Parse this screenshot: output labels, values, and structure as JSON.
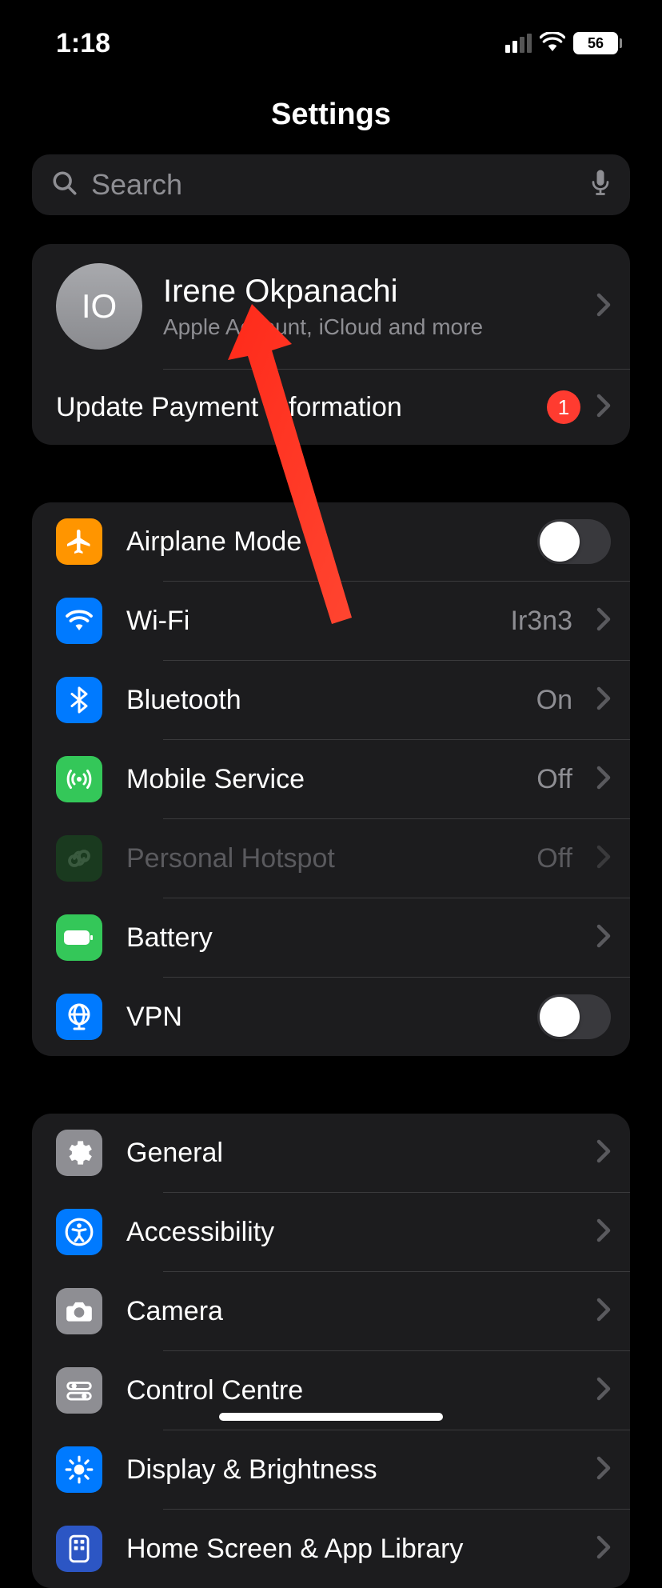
{
  "status": {
    "time": "1:18",
    "battery": "56"
  },
  "header": {
    "title": "Settings"
  },
  "search": {
    "placeholder": "Search"
  },
  "profile": {
    "initials": "IO",
    "name": "Irene Okpanachi",
    "subtitle": "Apple Account, iCloud and more",
    "payment_label": "Update Payment Information",
    "badge": "1"
  },
  "group1": {
    "airplane": {
      "label": "Airplane Mode"
    },
    "wifi": {
      "label": "Wi-Fi",
      "value": "Ir3n3"
    },
    "bluetooth": {
      "label": "Bluetooth",
      "value": "On"
    },
    "mobile": {
      "label": "Mobile Service",
      "value": "Off"
    },
    "hotspot": {
      "label": "Personal Hotspot",
      "value": "Off"
    },
    "battery": {
      "label": "Battery"
    },
    "vpn": {
      "label": "VPN"
    }
  },
  "group2": {
    "general": {
      "label": "General"
    },
    "accessibility": {
      "label": "Accessibility"
    },
    "camera": {
      "label": "Camera"
    },
    "control": {
      "label": "Control Centre"
    },
    "display": {
      "label": "Display & Brightness"
    },
    "home": {
      "label": "Home Screen & App Library"
    }
  },
  "colors": {
    "orange": "#ff9500",
    "blue": "#007aff",
    "green": "#34c759",
    "darkgreen": "#1a3a1f",
    "gray": "#8e8e93",
    "red": "#ff3b30"
  }
}
